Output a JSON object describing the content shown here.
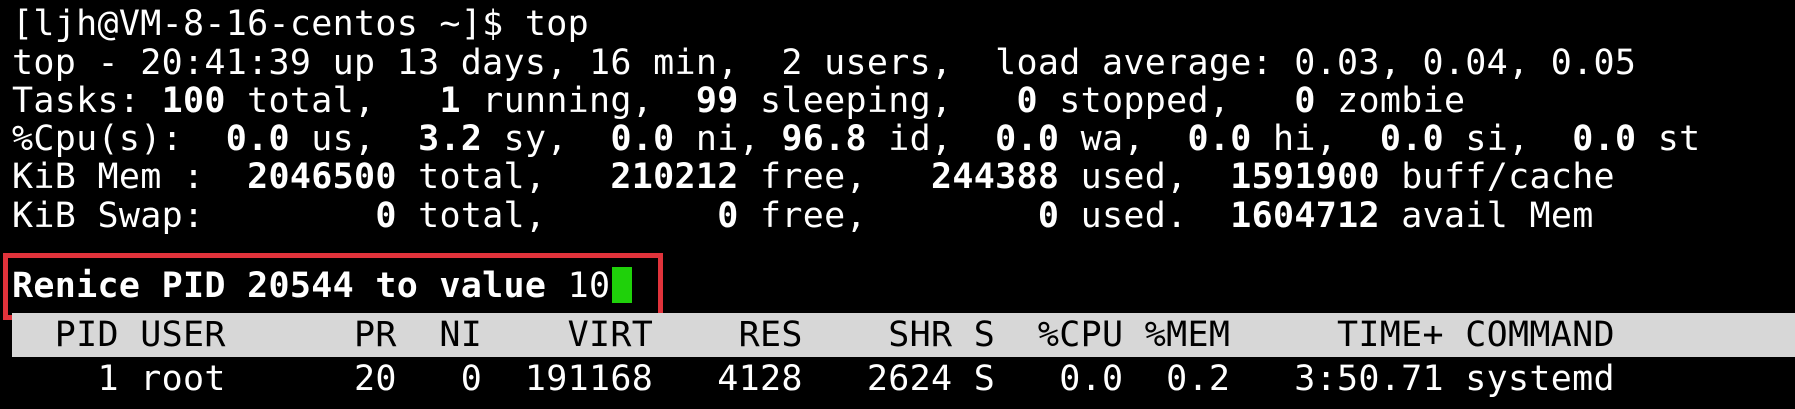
{
  "terminal": {
    "prompt_line": "[ljh@VM-8-16-centos ~]$ top",
    "summary": {
      "top_line": "top - 20:41:39 up 13 days, 16 min,  2 users,  load average: 0.03, 0.04, 0.05",
      "tasks": {
        "label": "Tasks: ",
        "total": "100",
        "total_label": " total,   ",
        "running": "1",
        "running_label": " running,  ",
        "sleeping": "99",
        "sleeping_label": " sleeping,   ",
        "stopped": "0",
        "stopped_label": " stopped,   ",
        "zombie": "0",
        "zombie_label": " zombie"
      },
      "cpu": {
        "label": "%Cpu(s):  ",
        "us": "0.0",
        "us_label": " us,  ",
        "sy": "3.2",
        "sy_label": " sy,  ",
        "ni": "0.0",
        "ni_label": " ni, ",
        "id": "96.8",
        "id_label": " id,  ",
        "wa": "0.0",
        "wa_label": " wa,  ",
        "hi": "0.0",
        "hi_label": " hi,  ",
        "si": "0.0",
        "si_label": " si,  ",
        "st": "0.0",
        "st_label": " st"
      },
      "mem": {
        "label": "KiB Mem :  ",
        "total": "2046500",
        "total_label": " total,   ",
        "free": "210212",
        "free_label": " free,   ",
        "used": "244388",
        "used_label": " used,  ",
        "cache": "1591900",
        "cache_label": " buff/cache"
      },
      "swap": {
        "label": "KiB Swap:        ",
        "total": "0",
        "total_label": " total,        ",
        "free": "0",
        "free_label": " free,        ",
        "used": "0",
        "used_label": " used.  ",
        "avail": "1604712",
        "avail_label": " avail Mem"
      }
    },
    "renice_prompt": {
      "text": "Renice PID 20544 to value ",
      "input_value": "10"
    },
    "process_header": "  PID USER      PR  NI    VIRT    RES    SHR S  %CPU %MEM     TIME+ COMMAND",
    "processes": [
      {
        "text": "    1 root      20   0  191168   4128   2624 S   0.0  0.2   3:50.71 systemd"
      }
    ],
    "colors": {
      "background": "#000000",
      "foreground": "#ffffff",
      "highlight_box": "#e0333b",
      "cursor": "#1fd10a",
      "header_bar": "#d7d7d7"
    }
  }
}
